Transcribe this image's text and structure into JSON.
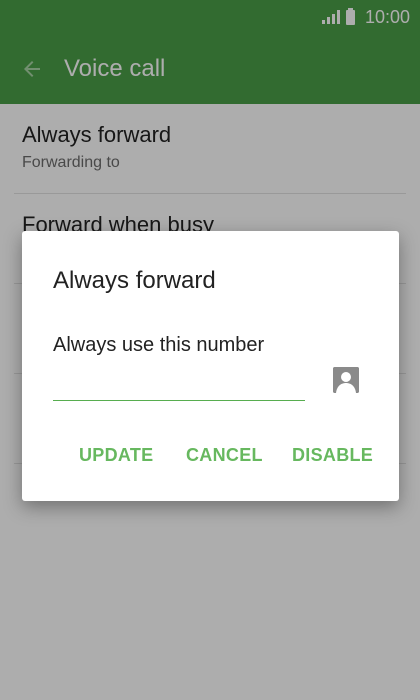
{
  "status_bar": {
    "time": "10:00",
    "icons": [
      "signal-icon",
      "battery-icon"
    ]
  },
  "app_bar": {
    "title": "Voice call",
    "back_icon": "arrow-left-icon"
  },
  "list": {
    "items": [
      {
        "title": "Always forward",
        "subtitle": "Forwarding to"
      },
      {
        "title": "Forward when busy",
        "subtitle": ""
      },
      {
        "title": "",
        "subtitle": ""
      },
      {
        "title": "",
        "subtitle": ""
      }
    ]
  },
  "dialog": {
    "title": "Always forward",
    "label": "Always use this number",
    "input": {
      "value": "",
      "placeholder": ""
    },
    "contact_icon": "contact-icon",
    "actions": {
      "update": "UPDATE",
      "cancel": "CANCEL",
      "disable": "DISABLE"
    }
  },
  "colors": {
    "primary": "#4b9e47",
    "accent": "#67b85f",
    "dialog_bg": "#ffffff"
  }
}
